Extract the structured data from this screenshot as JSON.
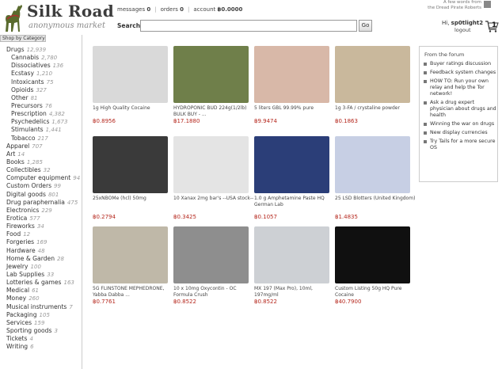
{
  "header": {
    "title": "Silk Road",
    "subtitle": "anonymous market",
    "nav": [
      {
        "label": "messages",
        "count": "0"
      },
      {
        "label": "orders",
        "count": "0"
      },
      {
        "label": "account",
        "count": "฿0.0000"
      }
    ],
    "news": [
      "A few words from",
      "the Dread Pirate Roberts"
    ],
    "search_label": "Search",
    "search_placeholder": "",
    "go_label": "Go",
    "greeting": "Hi,",
    "username": "sp0tlight2",
    "logout_label": "logout",
    "cart_count": "1"
  },
  "sidebar": {
    "header": "Shop by Category",
    "categories": [
      {
        "name": "Drugs",
        "count": "12,939",
        "sub": false
      },
      {
        "name": "Cannabis",
        "count": "2,780",
        "sub": true
      },
      {
        "name": "Dissociatives",
        "count": "136",
        "sub": true
      },
      {
        "name": "Ecstasy",
        "count": "1,210",
        "sub": true
      },
      {
        "name": "Intoxicants",
        "count": "75",
        "sub": true
      },
      {
        "name": "Opioids",
        "count": "327",
        "sub": true
      },
      {
        "name": "Other",
        "count": "81",
        "sub": true
      },
      {
        "name": "Precursors",
        "count": "76",
        "sub": true
      },
      {
        "name": "Prescription",
        "count": "4,382",
        "sub": true
      },
      {
        "name": "Psychedelics",
        "count": "1,673",
        "sub": true
      },
      {
        "name": "Stimulants",
        "count": "1,441",
        "sub": true
      },
      {
        "name": "Tobacco",
        "count": "217",
        "sub": true
      },
      {
        "name": "Apparel",
        "count": "707",
        "sub": false
      },
      {
        "name": "Art",
        "count": "14",
        "sub": false
      },
      {
        "name": "Books",
        "count": "1,285",
        "sub": false
      },
      {
        "name": "Collectibles",
        "count": "32",
        "sub": false
      },
      {
        "name": "Computer equipment",
        "count": "94",
        "sub": false
      },
      {
        "name": "Custom Orders",
        "count": "99",
        "sub": false
      },
      {
        "name": "Digital goods",
        "count": "801",
        "sub": false
      },
      {
        "name": "Drug paraphernalia",
        "count": "475",
        "sub": false
      },
      {
        "name": "Electronics",
        "count": "229",
        "sub": false
      },
      {
        "name": "Erotica",
        "count": "577",
        "sub": false
      },
      {
        "name": "Fireworks",
        "count": "34",
        "sub": false
      },
      {
        "name": "Food",
        "count": "12",
        "sub": false
      },
      {
        "name": "Forgeries",
        "count": "169",
        "sub": false
      },
      {
        "name": "Hardware",
        "count": "48",
        "sub": false
      },
      {
        "name": "Home & Garden",
        "count": "28",
        "sub": false
      },
      {
        "name": "Jewelry",
        "count": "100",
        "sub": false
      },
      {
        "name": "Lab Supplies",
        "count": "33",
        "sub": false
      },
      {
        "name": "Lotteries & games",
        "count": "163",
        "sub": false
      },
      {
        "name": "Medical",
        "count": "61",
        "sub": false
      },
      {
        "name": "Money",
        "count": "260",
        "sub": false
      },
      {
        "name": "Musical instruments",
        "count": "7",
        "sub": false
      },
      {
        "name": "Packaging",
        "count": "105",
        "sub": false
      },
      {
        "name": "Services",
        "count": "159",
        "sub": false
      },
      {
        "name": "Sporting goods",
        "count": "3",
        "sub": false
      },
      {
        "name": "Tickets",
        "count": "4",
        "sub": false
      },
      {
        "name": "Writing",
        "count": "6",
        "sub": false
      }
    ]
  },
  "products": [
    {
      "name": "1g High Quality Cocaine",
      "price": "฿0.8956",
      "thumb": "budshop-leaf-image",
      "bg": "#d9d9d9"
    },
    {
      "name": "HYDROPONIC BUD 224g(1/2lb) BULK BUY - ...",
      "price": "฿17.1880",
      "thumb": "cannabis-buds-image",
      "bg": "#6f7f4a"
    },
    {
      "name": "5 liters GBL 99.99% pure",
      "price": "฿9.9474",
      "thumb": "bags-image",
      "bg": "#d8b8a8"
    },
    {
      "name": "1g 3-FA / crystaline powder",
      "price": "฿0.1863",
      "thumb": "blotter-sheet-image",
      "bg": "#c9b89c"
    },
    {
      "name": "25xNBOMe (hcl) 50mg",
      "price": "฿0.2794",
      "thumb": "scale-image",
      "bg": "#3a3a3a"
    },
    {
      "name": "10 Xanax 2mg bar's --USA stock--",
      "price": "฿0.3425",
      "thumb": "xanax-bars-image",
      "bg": "#e4e4e4"
    },
    {
      "name": "1.0 g Amphetamine Paste HQ German Lab",
      "price": "฿0.1057",
      "thumb": "express-envelope-image",
      "bg": "#2b3e78"
    },
    {
      "name": "25 LSD Blotters (United Kingdom)",
      "price": "฿1.4835",
      "thumb": "lsd-blotter-image",
      "bg": "#c7cfe4"
    },
    {
      "name": "5G FLINSTONE MEPHEDRONE, Yabba Dabba ...",
      "price": "฿0.7761",
      "thumb": "crystals-image",
      "bg": "#bfb8a8"
    },
    {
      "name": "10 x 10mg Oxycontin - OC Formula Crush",
      "price": "฿0.8522",
      "thumb": "oc-pills-image",
      "bg": "#8e8e8e"
    },
    {
      "name": "MX 197 (Max Pro), 10ml, 197mg/ml",
      "price": "฿0.8522",
      "thumb": "vials-image",
      "bg": "#cdd0d4"
    },
    {
      "name": "Custom Listing 50g HQ Pure Cocaine",
      "price": "฿40.7900",
      "thumb": "rock-image",
      "bg": "#101010"
    }
  ],
  "forum": {
    "title": "From the forum",
    "items": [
      "Buyer ratings discussion",
      "Feedback system changes",
      "HOW TO: Run your own relay and help the Tor network!",
      "Ask a drug expert physician about drugs and health",
      "Winning the war on drugs",
      "New display currencies",
      "Try Tails for a more secure OS"
    ]
  },
  "colors": {
    "price": "#b5271d",
    "accent": "#3c3c3c"
  }
}
